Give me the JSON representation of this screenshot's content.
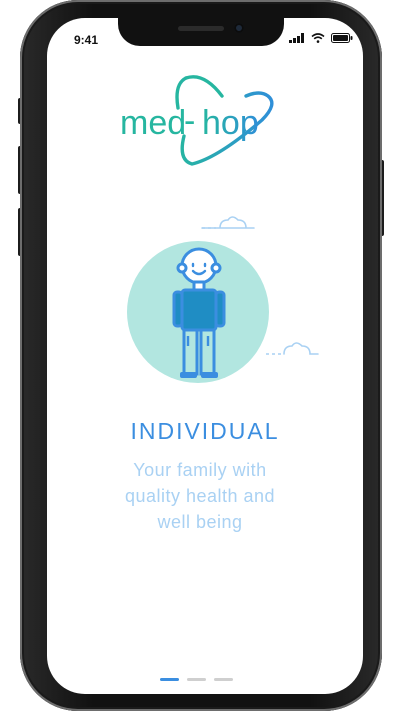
{
  "status_bar": {
    "time": "9:41"
  },
  "logo": {
    "text_left": "med",
    "dash": "-",
    "text_right": "hop"
  },
  "onboarding": {
    "title": "INDIVIDUAL",
    "subtitle_lines": [
      "Your family with",
      "quality health and",
      "well being"
    ]
  },
  "pager": {
    "pages": 3,
    "active_index": 0
  },
  "colors": {
    "brand_teal": "#21b3a0",
    "brand_blue": "#3b8ee0",
    "illustration_circle": "#b2e6e0",
    "subtitle": "#a9d1f3"
  },
  "icons": [
    "signal-icon",
    "wifi-icon",
    "battery-icon",
    "cloud-icon"
  ]
}
